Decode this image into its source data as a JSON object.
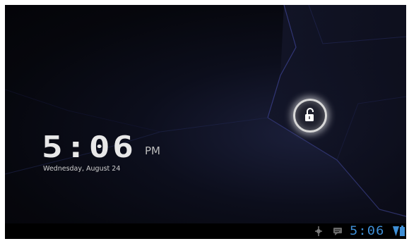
{
  "lock_screen": {
    "clock": {
      "time": "5:06",
      "ampm": "PM",
      "date": "Wednesday, August 24"
    },
    "unlock_icon": "unlock-padlock-icon"
  },
  "status_bar": {
    "time": "5:06",
    "icons": [
      "usb-debugging-icon",
      "notification-message-icon",
      "wifi-icon",
      "battery-icon"
    ],
    "accent_color": "#3f8fd6"
  }
}
